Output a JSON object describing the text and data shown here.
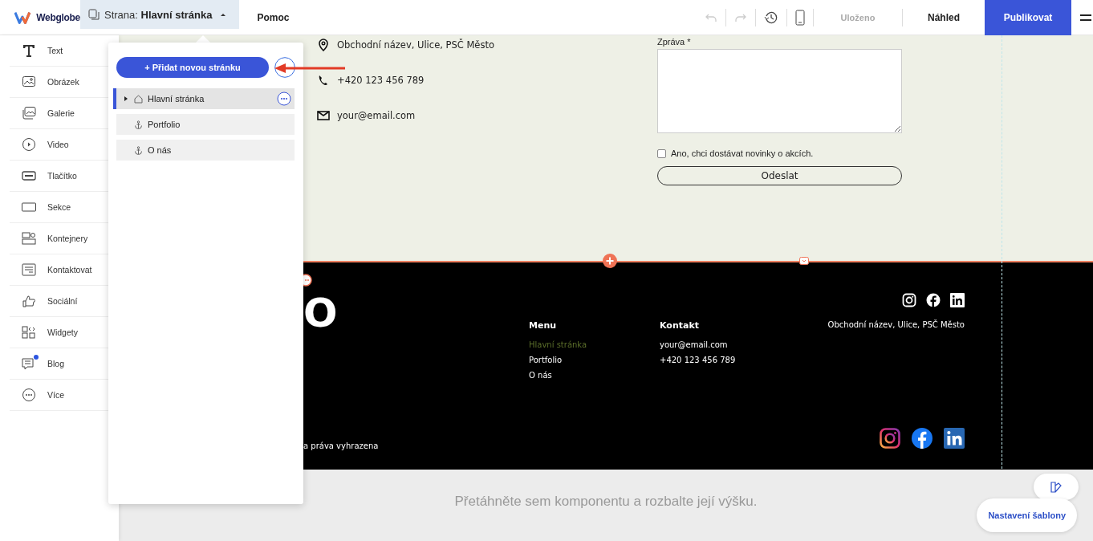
{
  "topbar": {
    "logo": "Webglobe",
    "page_selector": {
      "label": "Strana:",
      "value": "Hlavní stránka",
      "expanded": true
    },
    "help": "Pomoc",
    "status": "Uloženo",
    "preview": "Náhled",
    "publish": "Publikovat"
  },
  "sidebar": {
    "items": [
      {
        "kind": "text",
        "label": "Text",
        "notification": false
      },
      {
        "kind": "image",
        "label": "Obrázek",
        "notification": false
      },
      {
        "kind": "gallery",
        "label": "Galerie",
        "notification": false
      },
      {
        "kind": "video",
        "label": "Video",
        "notification": false
      },
      {
        "kind": "button",
        "label": "Tlačítko",
        "notification": false
      },
      {
        "kind": "section",
        "label": "Sekce",
        "notification": false
      },
      {
        "kind": "containers",
        "label": "Kontejnery",
        "notification": false
      },
      {
        "kind": "contact",
        "label": "Kontaktovat",
        "notification": false
      },
      {
        "kind": "social",
        "label": "Sociální",
        "notification": false
      },
      {
        "kind": "widgets",
        "label": "Widgety",
        "notification": false
      },
      {
        "kind": "blog",
        "label": "Blog",
        "notification": true
      },
      {
        "kind": "more",
        "label": "Více",
        "notification": false
      }
    ]
  },
  "pages_panel": {
    "add_button": "+ Přidat novou stránku",
    "pages": [
      {
        "kind": "home",
        "label": "Hlavní stránka",
        "selected": true
      },
      {
        "kind": "anchor",
        "label": "Portfolio",
        "selected": false
      },
      {
        "kind": "anchor",
        "label": "O nás",
        "selected": false
      }
    ]
  },
  "contact_section": {
    "items": [
      {
        "kind": "location",
        "text": "Obchodní název, Ulice, PSČ Město"
      },
      {
        "kind": "phone",
        "text": "+420 123 456 789"
      },
      {
        "kind": "email",
        "text": "your@email.com"
      }
    ],
    "form": {
      "message_label": "Zpráva *",
      "newsletter": {
        "label": "Ano, chci dostávat novinky o akcích.",
        "checked": false
      },
      "submit": "Odeslat"
    }
  },
  "footer": {
    "logo": "O",
    "copyright": "a práva vyhrazena",
    "menu": {
      "heading": "Menu",
      "links": [
        {
          "label": "Hlavní stránka",
          "selected": true
        },
        {
          "label": "Portfolio",
          "selected": false
        },
        {
          "label": "O nás",
          "selected": false
        }
      ]
    },
    "contact": {
      "heading": "Kontakt",
      "lines": [
        "your@email.com",
        "+420 123 456 789"
      ]
    },
    "address": "Obchodní název, Ulice, PSČ Město"
  },
  "drop_zone": {
    "hint": "Přetáhněte sem komponentu a rozbalte její výšku."
  },
  "template_settings": "Nastavení šablony"
}
